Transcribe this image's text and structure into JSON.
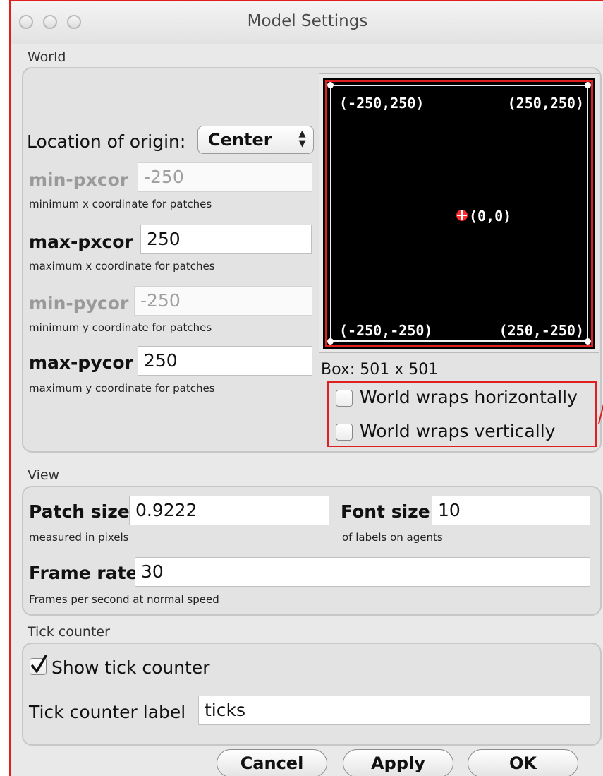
{
  "window": {
    "title": "Model Settings"
  },
  "world": {
    "section_label": "World",
    "origin_label": "Location of origin:",
    "origin_value": "Center",
    "min_pxcor": {
      "label": "min-pxcor",
      "value": "-250",
      "hint": "minimum x coordinate for patches"
    },
    "max_pxcor": {
      "label": "max-pxcor",
      "value": "250",
      "hint": "maximum x coordinate for patches"
    },
    "min_pycor": {
      "label": "min-pycor",
      "value": "-250",
      "hint": "minimum y coordinate for patches"
    },
    "max_pycor": {
      "label": "max-pycor",
      "value": "250",
      "hint": "maximum y coordinate for patches"
    },
    "preview": {
      "top_left": "(-250,250)",
      "top_right": "(250,250)",
      "center": "(0,0)",
      "bottom_left": "(-250,-250)",
      "bottom_right": "(250,-250)"
    },
    "box_label": "Box: 501 x 501",
    "wrap_horizontal": {
      "label": "World wraps horizontally",
      "checked": false
    },
    "wrap_vertical": {
      "label": "World wraps vertically",
      "checked": false
    }
  },
  "view": {
    "section_label": "View",
    "patch_size": {
      "label": "Patch size",
      "value": "0.9222",
      "hint": "measured in pixels"
    },
    "font_size": {
      "label": "Font size",
      "value": "10",
      "hint": "of labels on agents"
    },
    "frame_rate": {
      "label": "Frame rate",
      "value": "30",
      "hint": "Frames per second at normal speed"
    }
  },
  "tick_counter": {
    "section_label": "Tick counter",
    "show_label": "Show tick counter",
    "show_checked": true,
    "counter_label": "Tick counter label",
    "counter_value": "ticks"
  },
  "buttons": {
    "cancel": "Cancel",
    "apply": "Apply",
    "ok": "OK"
  },
  "colors": {
    "highlight": "#e02020",
    "preview_bg": "#000000",
    "origin_marker": "#ff2a2a"
  }
}
